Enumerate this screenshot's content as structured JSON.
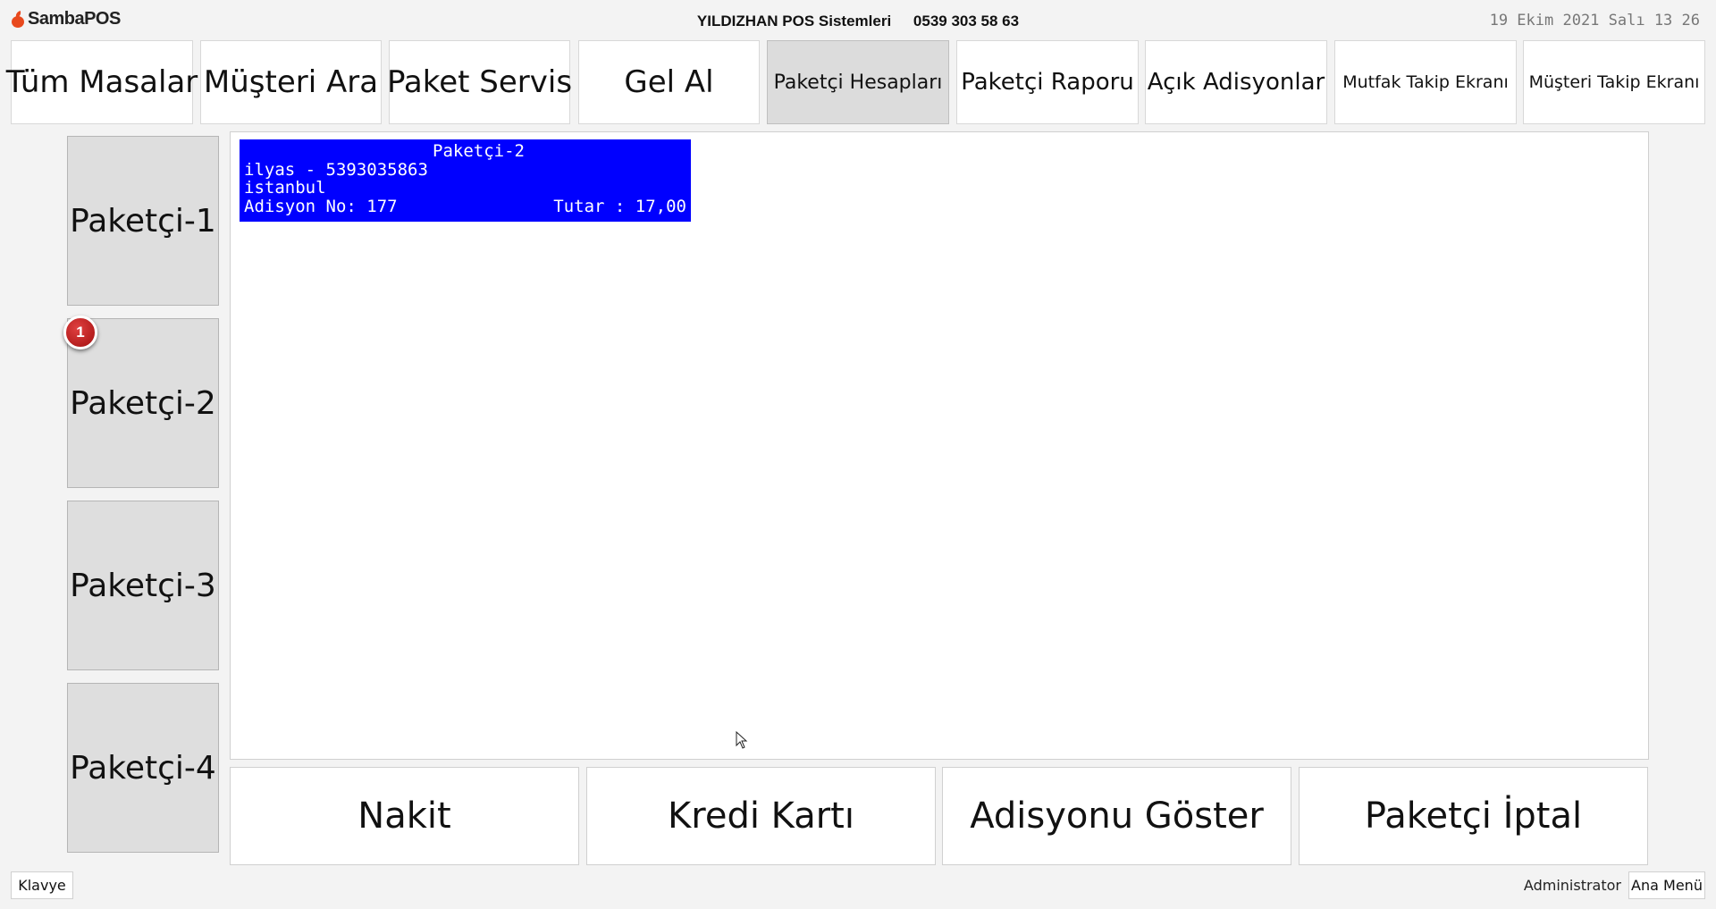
{
  "header": {
    "logo": "SambaPOS",
    "company_name": "YILDIZHAN POS Sistemleri",
    "phone": "0539 303 58 63",
    "datetime": "19 Ekim 2021 Salı 13 26"
  },
  "nav": {
    "items": [
      {
        "label": "Tüm Masalar"
      },
      {
        "label": "Müşteri Ara"
      },
      {
        "label": "Paket Servis"
      },
      {
        "label": "Gel Al"
      },
      {
        "label": "Paketçi Hesapları"
      },
      {
        "label": "Paketçi Raporu"
      },
      {
        "label": "Açık Adisyonlar"
      },
      {
        "label": "Mutfak Takip Ekranı"
      },
      {
        "label": "Müşteri Takip Ekranı"
      }
    ],
    "active": "Paketçi Hesapları"
  },
  "couriers": {
    "items": [
      {
        "label": "Paketçi-1"
      },
      {
        "label": "Paketçi-2"
      },
      {
        "label": "Paketçi-3"
      },
      {
        "label": "Paketçi-4"
      }
    ],
    "badge_count": "1"
  },
  "ticket": {
    "title": "Paketçi-2",
    "customer": "ilyas - 5393035863",
    "city": "istanbul",
    "order_no": "Adisyon No: 177",
    "total": "Tutar : 17,00",
    "bg_color": "#0000ff"
  },
  "actions": {
    "items": [
      {
        "label": "Nakit"
      },
      {
        "label": "Kredi Kartı"
      },
      {
        "label": "Adisyonu Göster"
      },
      {
        "label": "Paketçi İptal"
      }
    ]
  },
  "footer": {
    "keyboard": "Klavye",
    "user": "Administrator",
    "main_menu": "Ana Menü"
  }
}
